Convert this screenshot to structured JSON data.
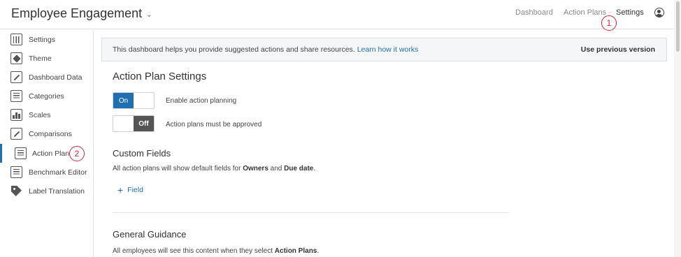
{
  "header": {
    "app_title": "Employee Engagement",
    "nav": [
      {
        "label": "Dashboard",
        "active": false
      },
      {
        "label": "Action Plans",
        "active": false
      },
      {
        "label": "Settings",
        "active": true
      }
    ],
    "callout_1": "1"
  },
  "sidebar": {
    "items": [
      {
        "label": "Settings",
        "icon": "sliders-icon"
      },
      {
        "label": "Theme",
        "icon": "paintbrush-icon"
      },
      {
        "label": "Dashboard Data",
        "icon": "pencil-icon"
      },
      {
        "label": "Categories",
        "icon": "list-icon"
      },
      {
        "label": "Scales",
        "icon": "bar-chart-icon"
      },
      {
        "label": "Comparisons",
        "icon": "pencil-icon"
      },
      {
        "label": "Action Plans",
        "icon": "clipboard-icon",
        "active": true
      },
      {
        "label": "Benchmark Editor",
        "icon": "list-icon"
      },
      {
        "label": "Label Translation",
        "icon": "tag-icon"
      }
    ],
    "callout_2": "2"
  },
  "banner": {
    "text": "This dashboard helps you provide suggested actions and share resources.",
    "link": "Learn how it works",
    "prev_version": "Use previous version"
  },
  "action_plan_settings": {
    "title": "Action Plan Settings",
    "toggle1": {
      "on_label": "On",
      "label": "Enable action planning",
      "state": "on"
    },
    "toggle2": {
      "off_label": "Off",
      "label": "Action plans must be approved",
      "state": "off"
    }
  },
  "custom_fields": {
    "title": "Custom Fields",
    "desc_prefix": "All action plans will show default fields for ",
    "owners": "Owners",
    "and": " and ",
    "due_date": "Due date",
    "period": ".",
    "add_plus": "+",
    "add_label": "Field"
  },
  "general_guidance": {
    "title": "General Guidance",
    "desc_prefix": "All employees will see this content when they select ",
    "action_plans": "Action Plans",
    "period": "."
  },
  "colors": {
    "accent": "#1f6fb2",
    "callout": "#c8273a",
    "toggle_off": "#555555"
  }
}
